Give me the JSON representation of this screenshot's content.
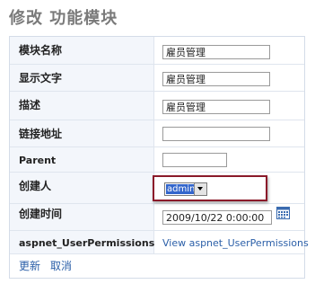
{
  "page": {
    "title": "修改 功能模块"
  },
  "form": {
    "module_name": {
      "label": "模块名称",
      "value": "雇员管理"
    },
    "display_text": {
      "label": "显示文字",
      "value": "雇员管理"
    },
    "description": {
      "label": "描述",
      "value": "雇员管理"
    },
    "link_address": {
      "label": "链接地址",
      "value": ""
    },
    "parent": {
      "label": "Parent",
      "value": ""
    },
    "creator": {
      "label": "创建人",
      "selected": "admin"
    },
    "created_time": {
      "label": "创建时间",
      "value": "2009/10/22 0:00:00"
    },
    "permissions": {
      "label": "aspnet_UserPermissions",
      "link_text": "View aspnet_UserPermissions"
    }
  },
  "actions": {
    "update_label": "更新",
    "cancel_label": "取消"
  },
  "colors": {
    "highlight_border": "#8b1a2a",
    "link": "#2b5fa8",
    "label_bg": "#f3f6fb"
  },
  "icons": {
    "calendar": "calendar-icon",
    "dropdown": "chevron-down-icon"
  }
}
